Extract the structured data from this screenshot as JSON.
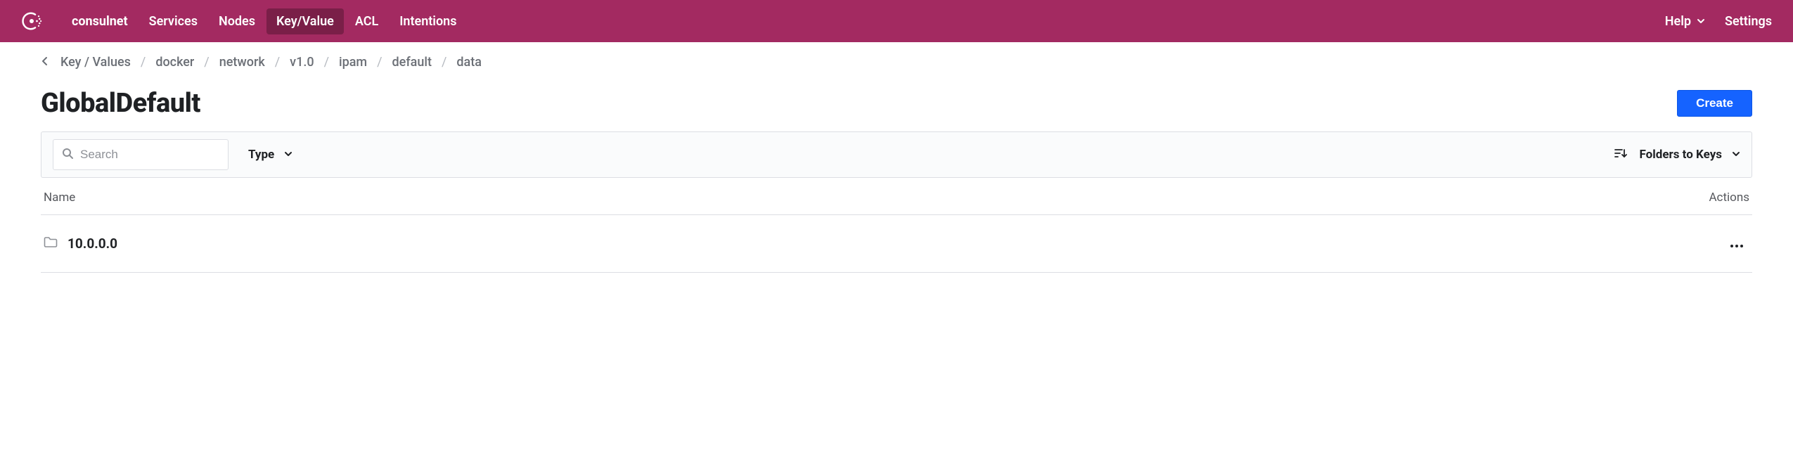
{
  "brand": "consulnet",
  "nav": {
    "items": [
      {
        "label": "Services",
        "active": false
      },
      {
        "label": "Nodes",
        "active": false
      },
      {
        "label": "Key/Value",
        "active": true
      },
      {
        "label": "ACL",
        "active": false
      },
      {
        "label": "Intentions",
        "active": false
      }
    ],
    "help_label": "Help",
    "settings_label": "Settings"
  },
  "breadcrumb": {
    "items": [
      "Key / Values",
      "docker",
      "network",
      "v1.0",
      "ipam",
      "default",
      "data"
    ]
  },
  "page": {
    "title": "GlobalDefault",
    "create_label": "Create"
  },
  "filters": {
    "search_placeholder": "Search",
    "type_label": "Type",
    "sort_label": "Folders to Keys"
  },
  "table": {
    "columns": {
      "name": "Name",
      "actions": "Actions"
    },
    "rows": [
      {
        "name": "10.0.0.0",
        "kind": "folder"
      }
    ]
  },
  "icons": {
    "sort": "sort-icon",
    "folder": "folder-icon",
    "search": "search-icon",
    "chevron_down": "chevron-down-icon",
    "chevron_left": "chevron-left-icon",
    "more": "more-icon"
  }
}
